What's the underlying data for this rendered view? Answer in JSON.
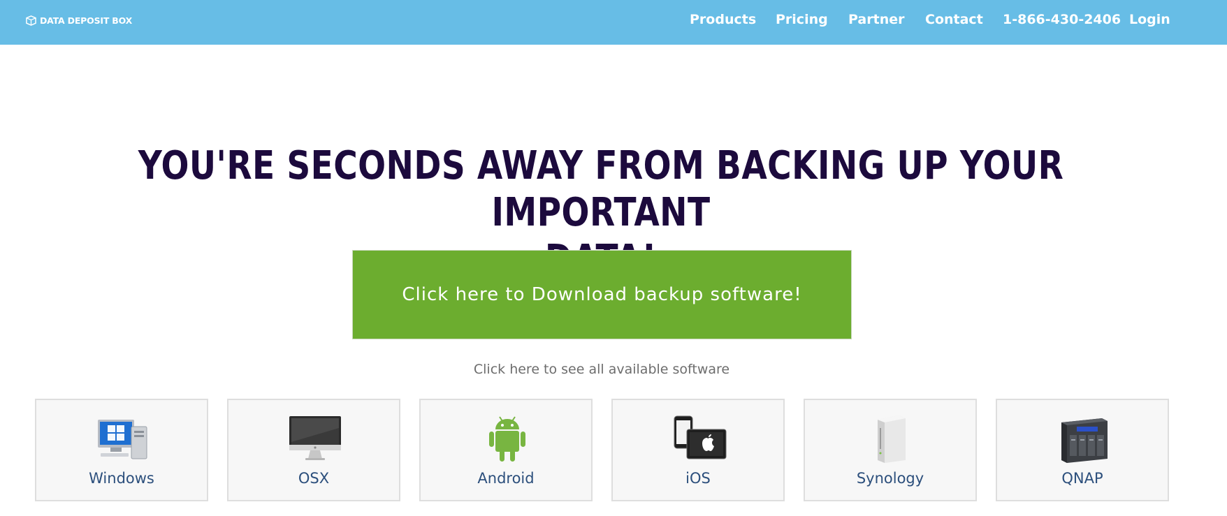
{
  "header": {
    "logo_text": "DATA DEPOSIT BOX",
    "nav": {
      "products": "Products",
      "pricing": "Pricing",
      "partner": "Partner",
      "contact": "Contact",
      "phone": "1-866-430-2406",
      "login": "Login"
    },
    "background_color": "#67bde6"
  },
  "hero": {
    "headline_line1": "YOU'RE SECONDS AWAY FROM BACKING UP YOUR IMPORTANT",
    "headline_line2": "DATA!",
    "download_button": "Click here to Download backup software!",
    "all_software_link": "Click here to see all available software",
    "button_color": "#6cad2f"
  },
  "platforms": {
    "windows": {
      "label": "Windows",
      "icon": "windows-pc-icon"
    },
    "osx": {
      "label": "OSX",
      "icon": "imac-icon"
    },
    "android": {
      "label": "Android",
      "icon": "android-icon"
    },
    "ios": {
      "label": "iOS",
      "icon": "ios-devices-icon"
    },
    "synology": {
      "label": "Synology",
      "icon": "synology-nas-icon"
    },
    "qnap": {
      "label": "QNAP",
      "icon": "qnap-nas-icon"
    }
  }
}
